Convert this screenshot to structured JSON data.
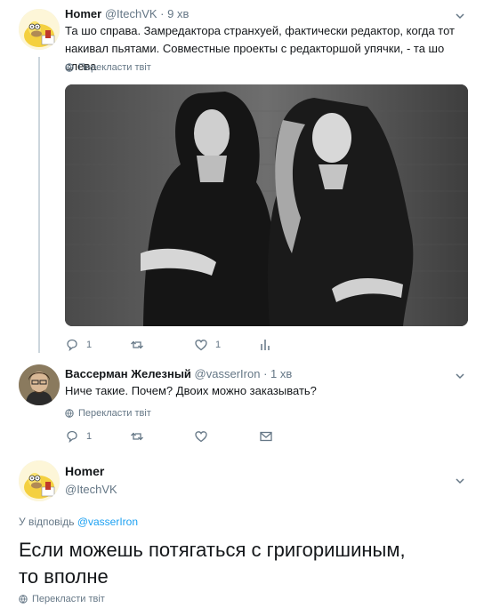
{
  "tweet1": {
    "name": "Homer",
    "handle": "@ItechVK",
    "dot": "·",
    "time": "9 хв",
    "text_line1": "Та шо справа. Замредактора странхуей, фактически редактор, когда тот",
    "text_line2": "накивал пьятами. Совместные проекты с редакторшой упячки, - та шо слева",
    "translate": "Перекласти твіт",
    "reply_count": "1",
    "retweet_count": "",
    "like_count": "1"
  },
  "tweet2": {
    "name": "Вассерман Железный",
    "handle": "@vasserIron",
    "dot": "·",
    "time": "1 хв",
    "text": "Ниче такие. Почем? Двоих можно заказывать?",
    "translate": "Перекласти твіт",
    "reply_count": "1"
  },
  "tweet3": {
    "name": "Homer",
    "handle": "@ItechVK",
    "reply_to_prefix": "У відповідь",
    "reply_to_handle": "@vasserIron",
    "text_line1": "Если можешь потягаться с григоришиным,",
    "text_line2": "то вполне",
    "translate": "Перекласти твіт"
  },
  "colors": {
    "accent": "#1da1f2",
    "secondary_text": "#657786",
    "primary_text": "#14171a",
    "thread_line": "#ccd6dd"
  },
  "icons": {
    "reply": "reply-icon",
    "retweet": "retweet-icon",
    "like": "heart-icon",
    "analytics": "analytics-icon",
    "dm": "envelope-icon",
    "more": "chevron-down-icon",
    "translate": "globe-icon"
  }
}
